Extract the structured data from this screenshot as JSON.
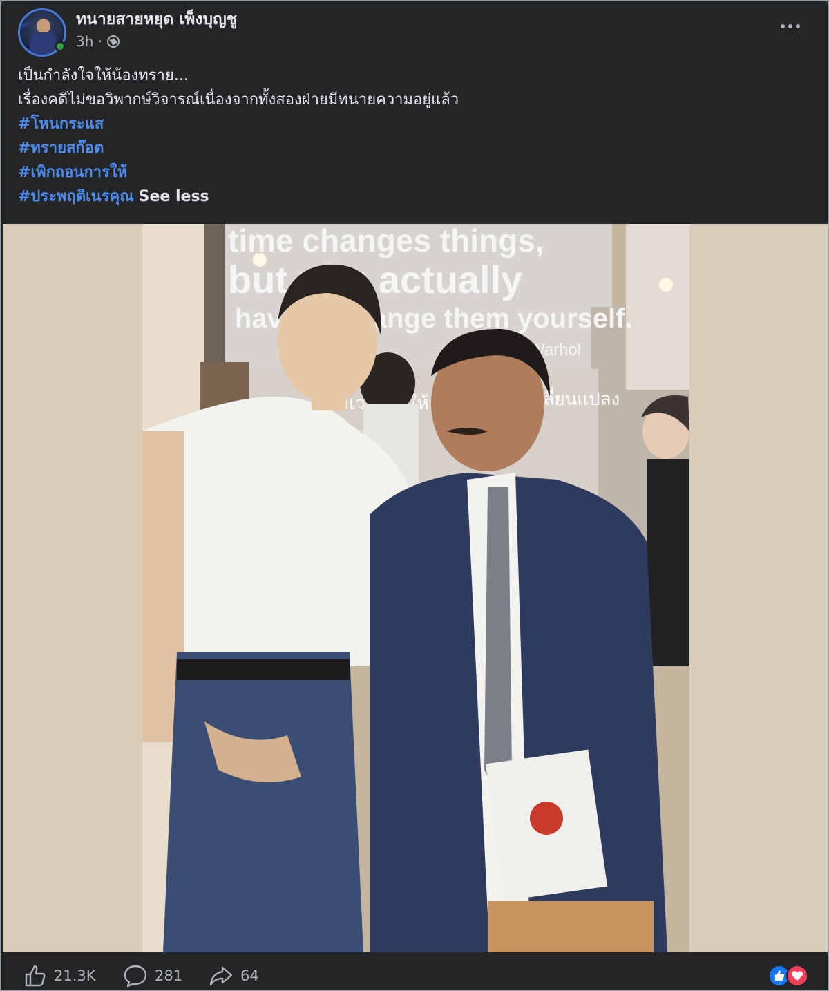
{
  "post": {
    "author": "ทนายสายหยุด เพ็งบุญชู",
    "time": "3h ·",
    "privacy_icon": "globe-icon",
    "text_lines": [
      "เป็นกำลังใจให้น้องทราย...",
      "เรื่องคดีไม่ขอวิพากษ์วิจารณ์เนื่องจากทั้งสองฝ่ายมีทนายความอยู่แล้ว"
    ],
    "hashtags": [
      "#โหนกระแส",
      "#ทรายสก๊อต",
      "#เพิกถอนการให้",
      "#ประพฤติเนรคุณ"
    ],
    "see_less": "See less"
  },
  "photo": {
    "wall_text": [
      "time changes things,",
      "but you actually",
      "have to change them yourself.",
      "Warhol",
      "ว่าเวลาทำให้",
      "เปลี่ยนแปลง"
    ]
  },
  "footer": {
    "like_count": "21.3K",
    "comment_count": "281",
    "share_count": "64",
    "reaction_icons": [
      "like-icon",
      "love-icon"
    ]
  },
  "colors": {
    "background": "#242526",
    "hashtag": "#4e8cf1",
    "online": "#31a24c"
  }
}
